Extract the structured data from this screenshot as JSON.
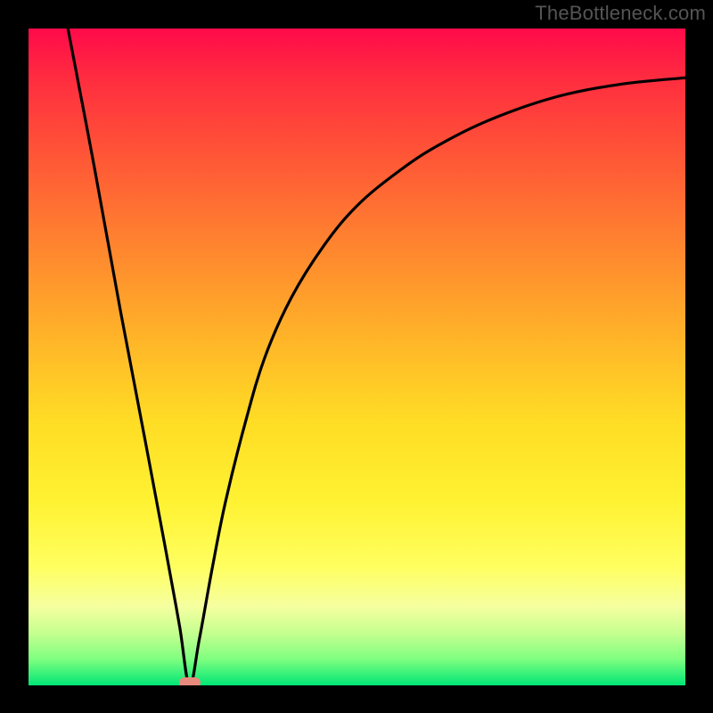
{
  "watermark": "TheBottleneck.com",
  "colors": {
    "frame": "#000000",
    "curve": "#000000",
    "marker": "#e98a7e",
    "gradient_top": "#ff0a4a",
    "gradient_bottom": "#00e676"
  },
  "chart_data": {
    "type": "line",
    "title": "",
    "xlabel": "",
    "ylabel": "",
    "xlim": [
      0,
      100
    ],
    "ylim": [
      0,
      100
    ],
    "grid": false,
    "legend": false,
    "annotations": [
      {
        "name": "sweet-spot-marker",
        "x": 24.5,
        "y": 0
      }
    ],
    "series": [
      {
        "name": "bottleneck-curve",
        "x": [
          6,
          10,
          14,
          18,
          21,
          23,
          24.5,
          26,
          28,
          30,
          33,
          36,
          40,
          45,
          50,
          56,
          62,
          70,
          80,
          90,
          100
        ],
        "y": [
          100,
          79,
          57,
          36,
          20,
          9,
          0,
          7,
          18,
          28,
          40,
          50,
          59,
          67,
          73,
          78,
          82,
          86,
          89.5,
          91.5,
          92.5
        ]
      }
    ]
  }
}
